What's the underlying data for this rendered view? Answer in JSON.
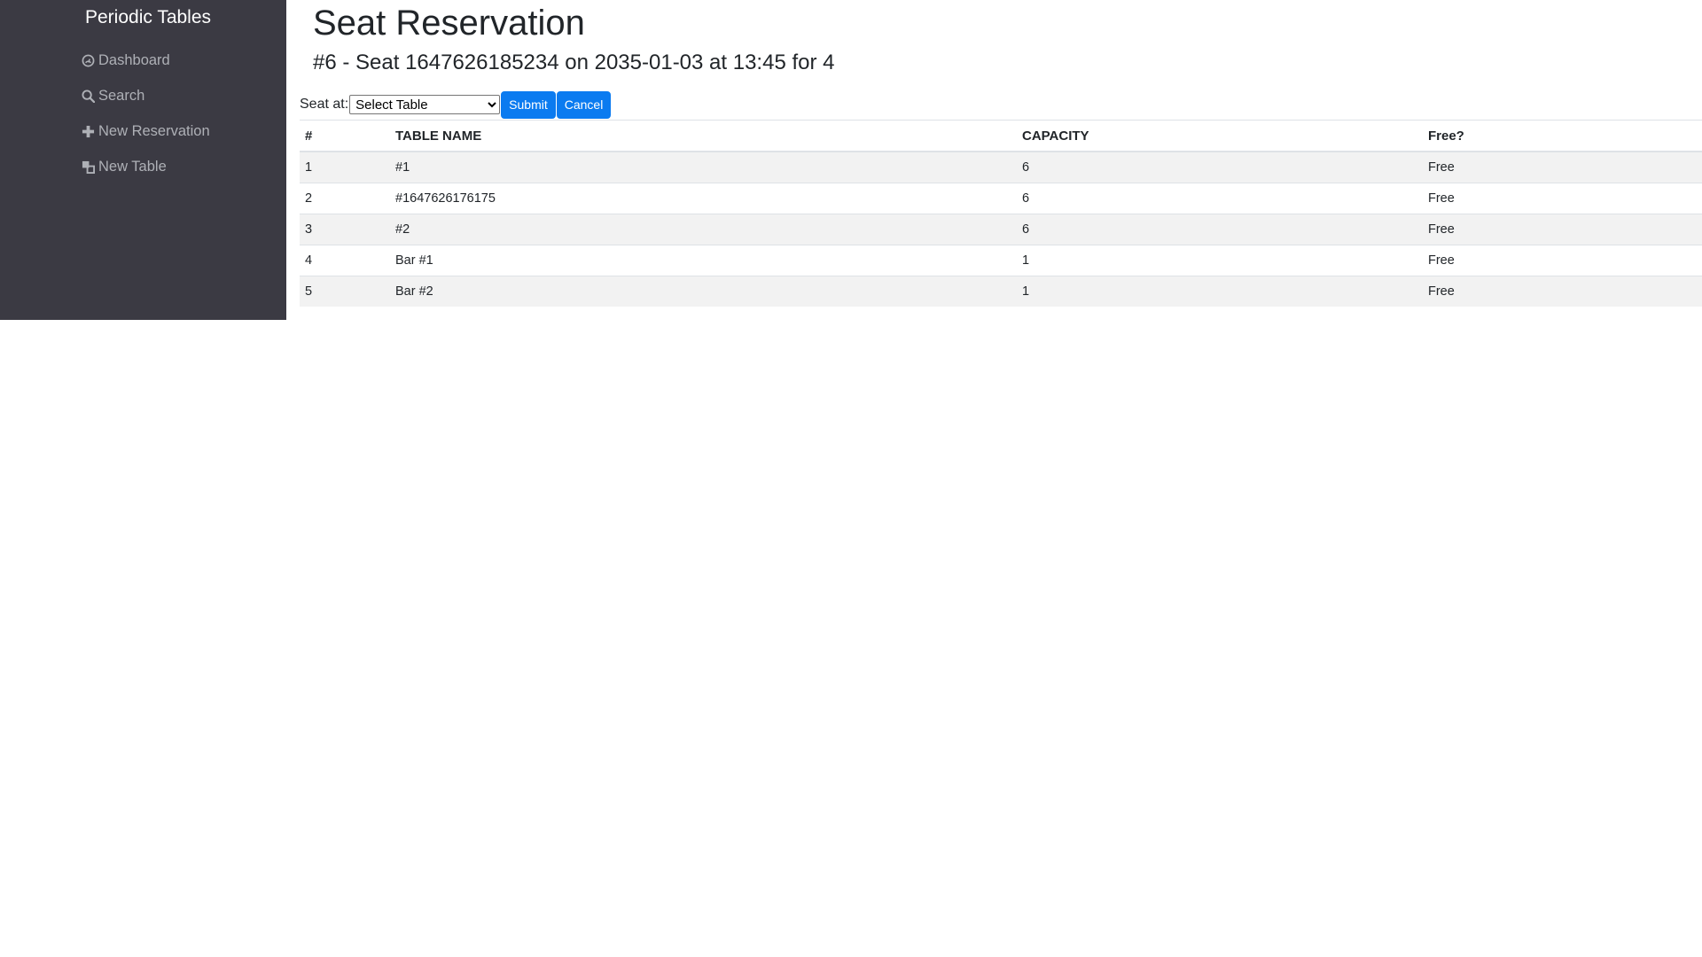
{
  "sidebar": {
    "brand": "Periodic Tables",
    "items": [
      {
        "label": "Dashboard",
        "icon": "dashboard-icon"
      },
      {
        "label": "Search",
        "icon": "search-icon"
      },
      {
        "label": "New Reservation",
        "icon": "plus-icon"
      },
      {
        "label": "New Table",
        "icon": "table-icon"
      }
    ]
  },
  "page": {
    "title": "Seat Reservation",
    "subtitle": "#6 - Seat 1647626185234 on 2035-01-03 at 13:45 for 4"
  },
  "form": {
    "seat_label": "Seat at:",
    "select_value": "Select Table",
    "submit_label": "Submit",
    "cancel_label": "Cancel"
  },
  "table": {
    "headers": [
      "#",
      "TABLE NAME",
      "CAPACITY",
      "Free?"
    ],
    "rows": [
      [
        "1",
        "#1",
        "6",
        "Free"
      ],
      [
        "2",
        "#1647626176175",
        "6",
        "Free"
      ],
      [
        "3",
        "#2",
        "6",
        "Free"
      ],
      [
        "4",
        "Bar #1",
        "1",
        "Free"
      ],
      [
        "5",
        "Bar #2",
        "1",
        "Free"
      ]
    ]
  },
  "colors": {
    "sidebar_bg": "#3b3a43",
    "accent": "#0b7bf0",
    "nav_text": "#aeb0b6"
  }
}
